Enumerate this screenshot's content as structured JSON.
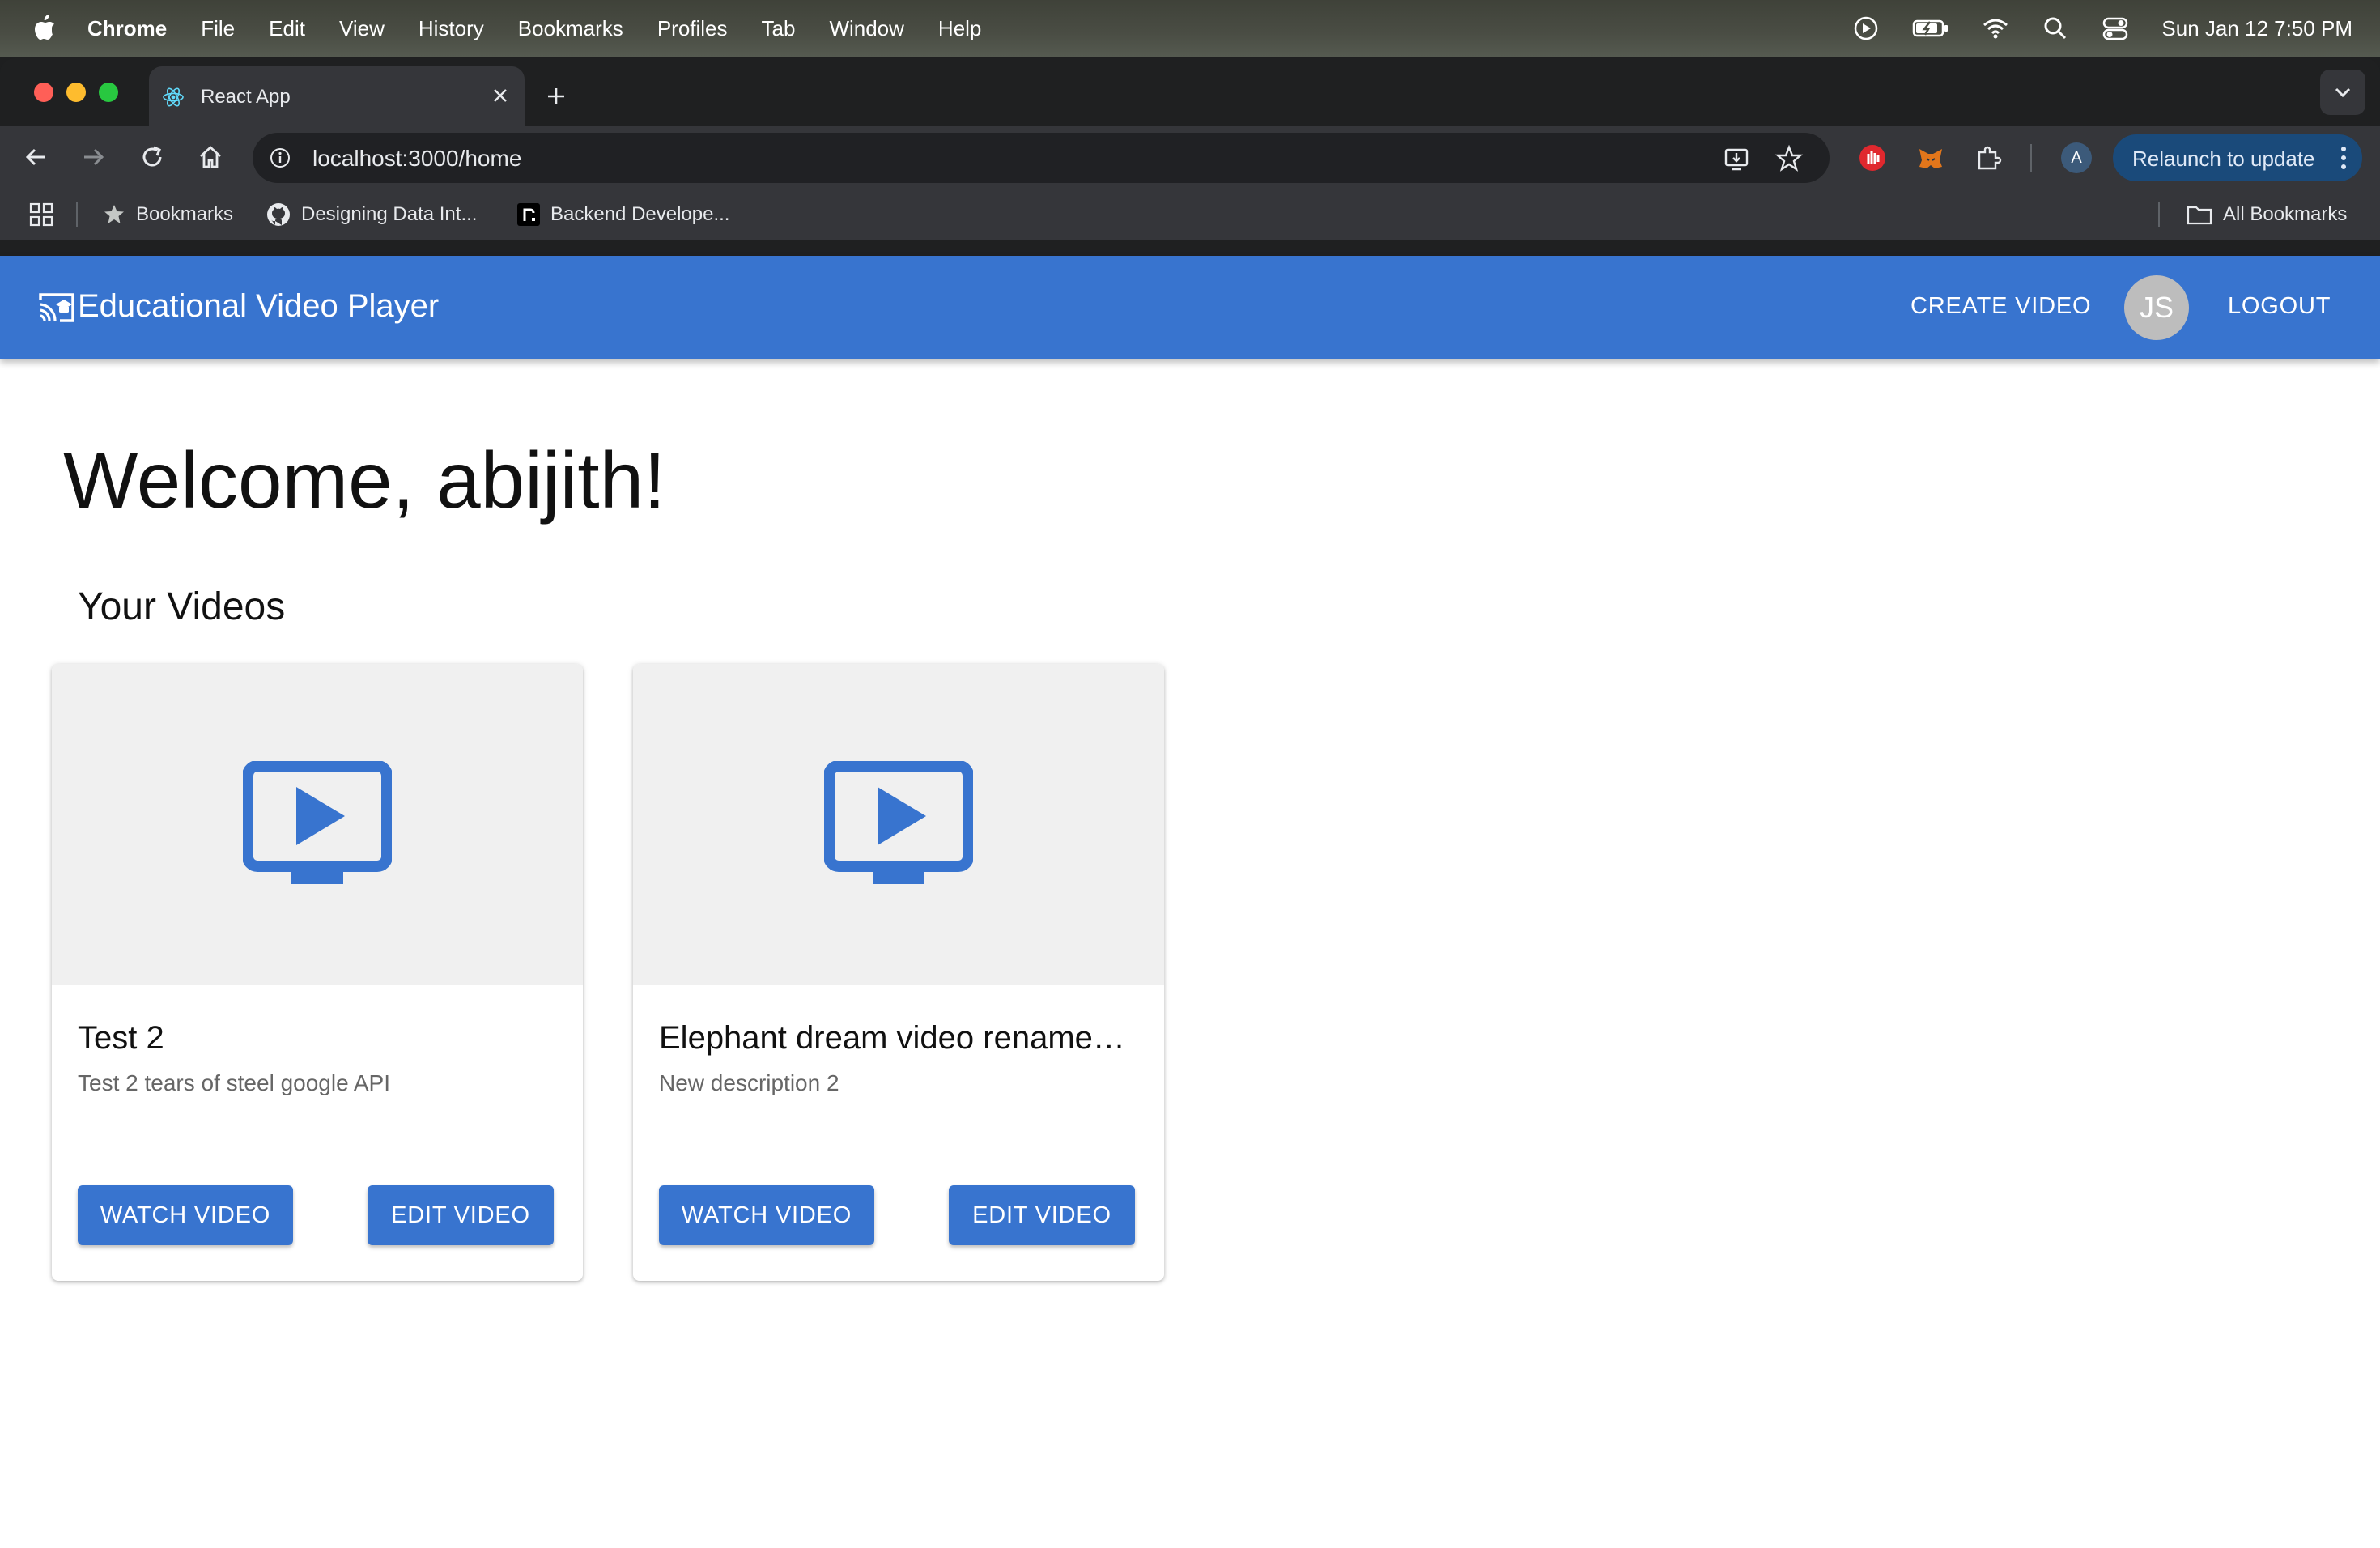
{
  "menubar": {
    "app_name": "Chrome",
    "menus": [
      "File",
      "Edit",
      "View",
      "History",
      "Bookmarks",
      "Profiles",
      "Tab",
      "Window",
      "Help"
    ],
    "clock": "Sun Jan 12  7:50 PM"
  },
  "browser": {
    "tab_title": "React App",
    "url": "localhost:3000/home",
    "relaunch_label": "Relaunch to update",
    "profile_initial": "A",
    "bookmarks": {
      "label": "Bookmarks",
      "items": [
        "Designing Data Int...",
        "Backend Develope..."
      ],
      "all_bookmarks": "All Bookmarks"
    }
  },
  "app": {
    "brand": "Educational Video Player",
    "create_label": "CREATE VIDEO",
    "avatar_initials": "JS",
    "logout_label": "LOGOUT",
    "welcome": "Welcome, abijith!",
    "section_title": "Your Videos",
    "videos": [
      {
        "title": "Test 2",
        "description": "Test 2 tears of steel google API",
        "watch_label": "WATCH VIDEO",
        "edit_label": "EDIT VIDEO"
      },
      {
        "title": "Elephant dream video rename…",
        "description": "New description 2",
        "watch_label": "WATCH VIDEO",
        "edit_label": "EDIT VIDEO"
      }
    ]
  },
  "colors": {
    "accent": "#3874cf",
    "thumbnail_bg": "#f0f0f0",
    "avatar_bg": "#bdbdbd"
  }
}
